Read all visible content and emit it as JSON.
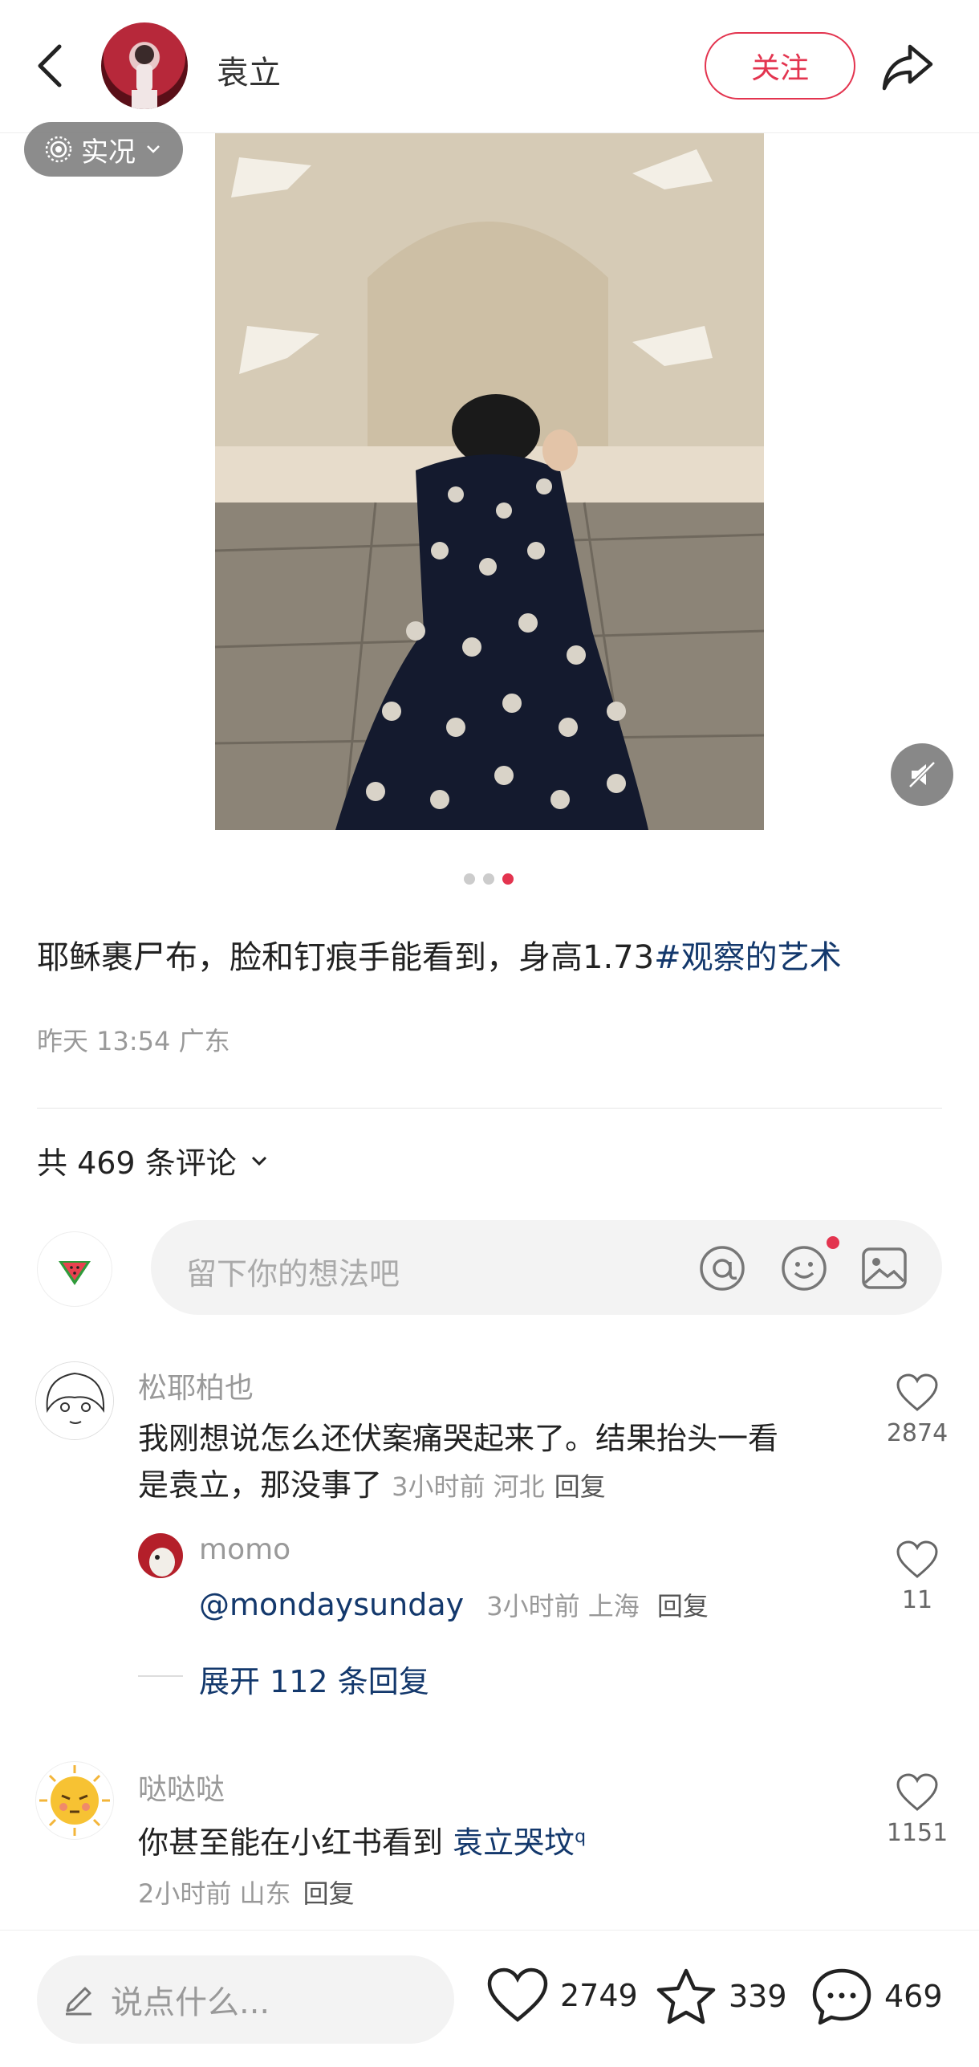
{
  "header": {
    "author_name": "袁立",
    "follow_label": "关注"
  },
  "media": {
    "live_label": "实况"
  },
  "post": {
    "caption_text": "耶稣裹尸布，脸和钉痕手能看到，身高1.73",
    "caption_tag": "#观察的艺术",
    "meta": "昨天 13:54 广东"
  },
  "comments_header": {
    "count_label": "共 469 条评论"
  },
  "comment_input": {
    "placeholder": "留下你的想法吧"
  },
  "comments": [
    {
      "name": "松耶柏也",
      "text_line1": "我刚想说怎么还伏案痛哭起来了。结果抬头一看",
      "text_line2": "是袁立，那没事了",
      "meta": "3小时前 河北",
      "reply_label": "回复",
      "likes": "2874",
      "reply": {
        "name": "momo",
        "text": "@mondaysunday",
        "meta": "3小时前 上海",
        "reply_label": "回复",
        "likes": "11"
      },
      "expand_label": "展开 112 条回复"
    },
    {
      "name": "哒哒哒",
      "text": "你甚至能在小红书看到 ",
      "link_text": "袁立哭坟",
      "meta": "2小时前 山东",
      "reply_label": "回复",
      "likes": "1151"
    }
  ],
  "bottom_bar": {
    "say_placeholder": "说点什么...",
    "likes": "2749",
    "collects": "339",
    "comments": "469"
  },
  "colors": {
    "accent": "#e3344f",
    "link": "#13386c"
  }
}
